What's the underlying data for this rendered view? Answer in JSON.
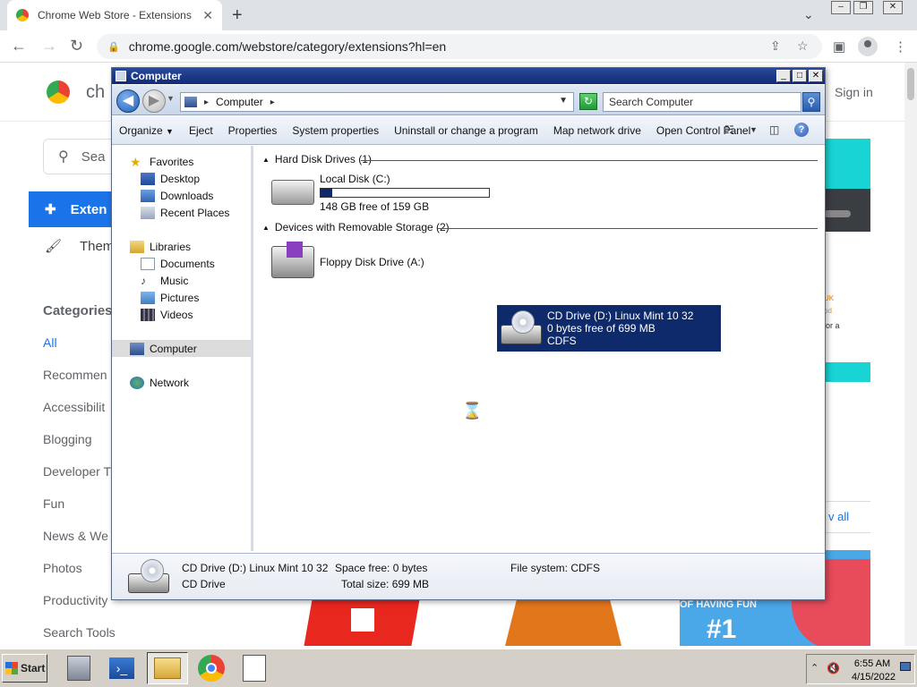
{
  "browser": {
    "tab_title": "Chrome Web Store - Extensions",
    "url": "chrome.google.com/webstore/category/extensions?hl=en"
  },
  "webstore": {
    "logo_text": "ch",
    "sign_in": "Sign in",
    "search_placeholder": "Sea",
    "nav_extensions": "Exten",
    "nav_themes": "Them",
    "categories_title": "Categories",
    "categories": [
      "All",
      "Recommen",
      "Accessibilit",
      "Blogging",
      "Developer T",
      "Fun",
      "News & We",
      "Photos",
      "Productivity",
      "Search Tools"
    ],
    "view_all": "v all",
    "card_text_1": "UK",
    "card_text_2": "od",
    "card_text_3": "or a",
    "tile_text_1": "OF HAVING FUN",
    "tile_text_2": "#1"
  },
  "explorer": {
    "title": "Computer",
    "address": "Computer",
    "search_placeholder": "Search Computer",
    "commands": [
      "Organize",
      "Eject",
      "Properties",
      "System properties",
      "Uninstall or change a program",
      "Map network drive",
      "Open Control Panel"
    ],
    "nav": {
      "favorites": "Favorites",
      "favorites_items": [
        "Desktop",
        "Downloads",
        "Recent Places"
      ],
      "libraries": "Libraries",
      "libraries_items": [
        "Documents",
        "Music",
        "Pictures",
        "Videos"
      ],
      "computer": "Computer",
      "network": "Network"
    },
    "groups": {
      "hdd_header": "Hard Disk Drives (1)",
      "removable_header": "Devices with Removable Storage (2)"
    },
    "drives": {
      "c_name": "Local Disk (C:)",
      "c_free": "148 GB free of 159 GB",
      "c_used_fraction": 0.07,
      "floppy_name": "Floppy Disk Drive (A:)",
      "cd_name": "CD Drive (D:) Linux Mint 10 32",
      "cd_free": "0 bytes free of 699 MB",
      "cd_fs": "CDFS"
    },
    "details": {
      "name": "CD Drive (D:) Linux Mint 10 32",
      "type": "CD Drive",
      "space_free": "Space free: 0 bytes",
      "total_size": "Total size: 699 MB",
      "file_system": "File system: CDFS"
    }
  },
  "taskbar": {
    "start": "Start",
    "time": "6:55 AM",
    "date": "4/15/2022"
  },
  "colors": {
    "selection": "#0e2a6b",
    "chrome_blue": "#1a73e8",
    "titlebar": "#1f3a8a"
  }
}
